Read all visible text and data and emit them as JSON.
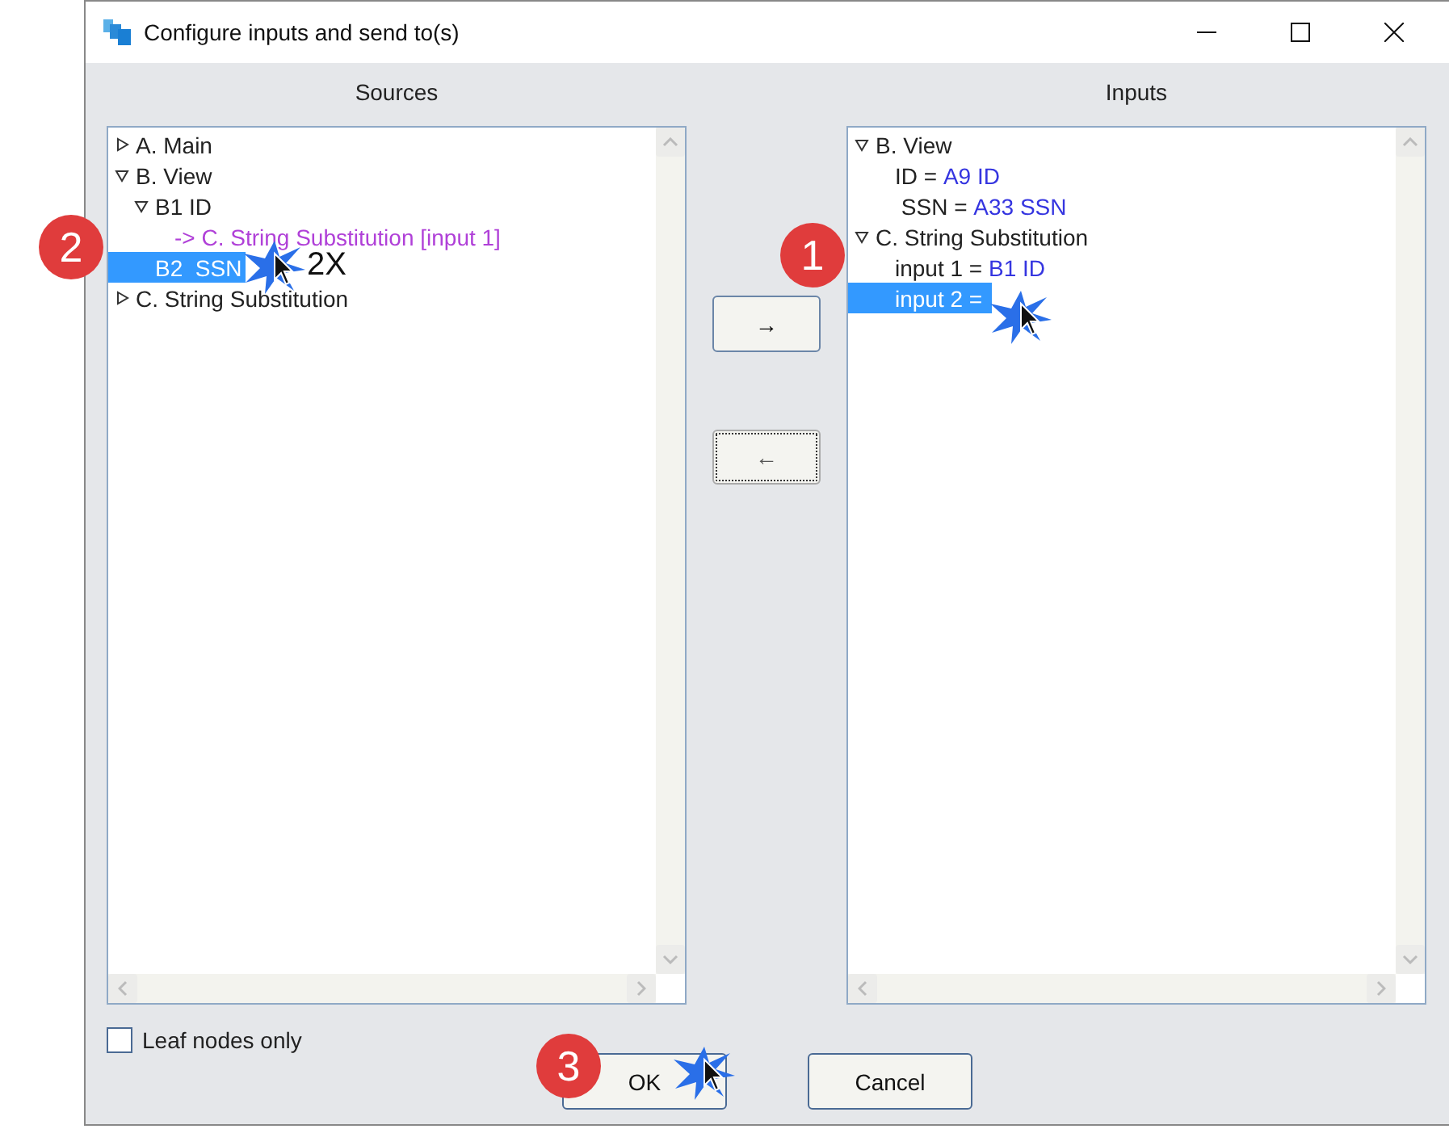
{
  "window": {
    "title": "Configure inputs and send to(s)"
  },
  "sources": {
    "heading": "Sources",
    "tree": [
      {
        "label": "A. Main",
        "expanded": false,
        "selected": false
      },
      {
        "label": "B. View",
        "expanded": true,
        "selected": false,
        "children": [
          {
            "label": "B1 ID",
            "expanded": true,
            "selected": false,
            "children": [
              {
                "kind": "reference",
                "label": "-> C. String Substitution [input 1]",
                "selected": false
              }
            ]
          },
          {
            "label": "B2  SSN",
            "selected": true
          }
        ]
      },
      {
        "label": "C. String Substitution",
        "expanded": false,
        "selected": false
      }
    ]
  },
  "move_buttons": [
    {
      "label": "→",
      "focused": false
    },
    {
      "label": "←",
      "focused": true
    }
  ],
  "inputs": {
    "heading": "Inputs",
    "tree": [
      {
        "label": "B. View",
        "expanded": true,
        "selected": false,
        "children": [
          {
            "label": "ID = ",
            "value": "A9 ID",
            "selected": false
          },
          {
            "label": " SSN = ",
            "value": "A33 SSN",
            "selected": false
          }
        ]
      },
      {
        "label": "C. String Substitution",
        "expanded": true,
        "selected": false,
        "children": [
          {
            "label": "input 1 = ",
            "value": "B1 ID",
            "selected": false
          },
          {
            "label": "input 2 = ",
            "selected": true
          }
        ]
      }
    ]
  },
  "leaf_nodes_only": {
    "label": "Leaf nodes only",
    "checked": false
  },
  "buttons": [
    {
      "label": "OK"
    },
    {
      "label": "Cancel"
    }
  ],
  "annotations": [
    {
      "number": "2"
    },
    {
      "number": "1"
    },
    {
      "number": "3"
    }
  ],
  "click_note": "2X"
}
